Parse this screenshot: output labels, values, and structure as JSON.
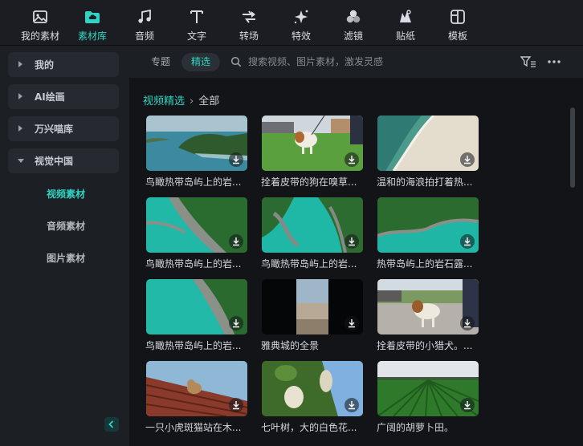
{
  "toolbar": {
    "items": [
      {
        "label": "我的素材",
        "icon": "image-folder-icon"
      },
      {
        "label": "素材库",
        "icon": "cloud-folder-icon",
        "active": true
      },
      {
        "label": "音频",
        "icon": "music-note-icon"
      },
      {
        "label": "文字",
        "icon": "text-t-icon"
      },
      {
        "label": "转场",
        "icon": "transition-arrows-icon"
      },
      {
        "label": "特效",
        "icon": "sparkle-star-icon"
      },
      {
        "label": "滤镜",
        "icon": "filter-circles-icon"
      },
      {
        "label": "贴纸",
        "icon": "sticker-icon"
      },
      {
        "label": "模板",
        "icon": "template-grid-icon"
      }
    ]
  },
  "sidebar": {
    "categories": [
      {
        "label": "我的",
        "expanded": false
      },
      {
        "label": "AI绘画",
        "expanded": false
      },
      {
        "label": "万兴喵库",
        "expanded": false
      },
      {
        "label": "视觉中国",
        "expanded": true
      }
    ],
    "subitems": [
      {
        "label": "视频素材",
        "active": true
      },
      {
        "label": "音频素材",
        "active": false
      },
      {
        "label": "图片素材",
        "active": false
      }
    ]
  },
  "filterbar": {
    "topic_label": "专题",
    "selected_label": "精选",
    "search_placeholder": "搜索视频、图片素材，激发灵感"
  },
  "breadcrumb": {
    "parent": "视频精选",
    "current": "全部"
  },
  "colors": {
    "accent": "#2fd5c3",
    "sidebar_bg": "#1c1f24",
    "content_bg": "#121417"
  },
  "grid": {
    "items": [
      {
        "title": "鸟瞰热带岛屿上的岩..."
      },
      {
        "title": "拴着皮带的狗在嗅草..."
      },
      {
        "title": "温和的海浪拍打着热..."
      },
      {
        "title": "鸟瞰热带岛屿上的岩..."
      },
      {
        "title": "鸟瞰热带岛屿上的岩..."
      },
      {
        "title": "热带岛屿上的岩石露..."
      },
      {
        "title": "鸟瞰热带岛屿上的岩..."
      },
      {
        "title": "雅典城的全景"
      },
      {
        "title": "拴着皮带的小猎犬。..."
      },
      {
        "title": "一只小虎斑猫站在木..."
      },
      {
        "title": "七叶树，大的白色花..."
      },
      {
        "title": "广阔的胡萝卜田。"
      }
    ]
  }
}
